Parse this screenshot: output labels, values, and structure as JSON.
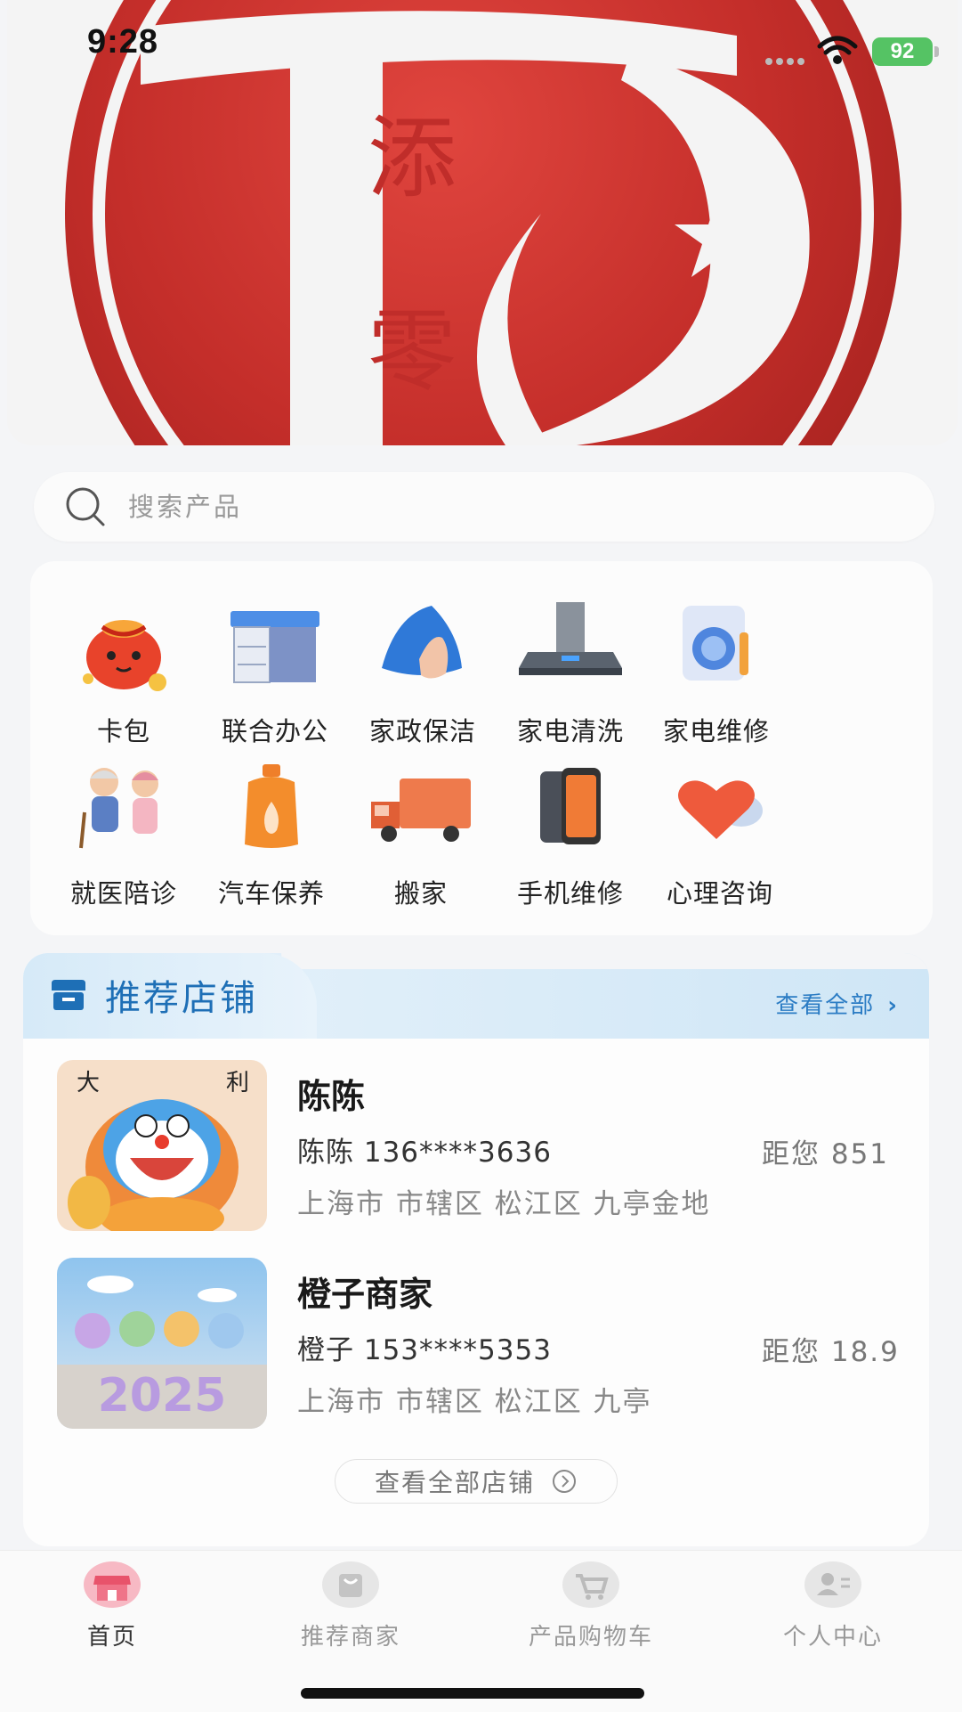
{
  "status_bar": {
    "time": "9:28",
    "battery": "92"
  },
  "hero": {
    "logo_chars": [
      "添",
      "零"
    ]
  },
  "search": {
    "placeholder": "搜索产品"
  },
  "categories": [
    {
      "label": "卡包",
      "icon": "gift-bag-icon"
    },
    {
      "label": "联合办公",
      "icon": "office-desk-icon"
    },
    {
      "label": "家政保洁",
      "icon": "cleaning-cloth-icon"
    },
    {
      "label": "家电清洗",
      "icon": "range-hood-icon"
    },
    {
      "label": "家电维修",
      "icon": "washing-machine-repair-icon"
    },
    {
      "label": "就医陪诊",
      "icon": "elderly-nurse-icon"
    },
    {
      "label": "汽车保养",
      "icon": "car-care-bottle-icon"
    },
    {
      "label": "搬家",
      "icon": "moving-truck-icon"
    },
    {
      "label": "手机维修",
      "icon": "phone-repair-icon"
    },
    {
      "label": "心理咨询",
      "icon": "heart-chat-icon"
    }
  ],
  "shops": {
    "title": "推荐店铺",
    "view_all": "查看全部",
    "items": [
      {
        "name": "陈陈",
        "contact": "陈陈 136****3636",
        "distance": "距您  851",
        "address": "上海市 市辖区 松江区 九亭金地",
        "thumb_text": [
          "大",
          "利"
        ]
      },
      {
        "name": "橙子商家",
        "contact": "橙子 153****5353",
        "distance": "距您  18.9",
        "address": "上海市 市辖区 松江区 九亭",
        "thumb_text": [
          "2025"
        ]
      }
    ],
    "more_button": "查看全部店铺"
  },
  "tabbar": [
    {
      "label": "首页",
      "icon": "shop-home-icon",
      "active": true
    },
    {
      "label": "推荐商家",
      "icon": "shopping-bag-icon",
      "active": false
    },
    {
      "label": "产品购物车",
      "icon": "cart-icon",
      "active": false
    },
    {
      "label": "个人中心",
      "icon": "user-card-icon",
      "active": false
    }
  ],
  "colors": {
    "brand_red": "#c02d2a",
    "accent_blue": "#1e6fb6",
    "battery_green": "#55c364"
  }
}
